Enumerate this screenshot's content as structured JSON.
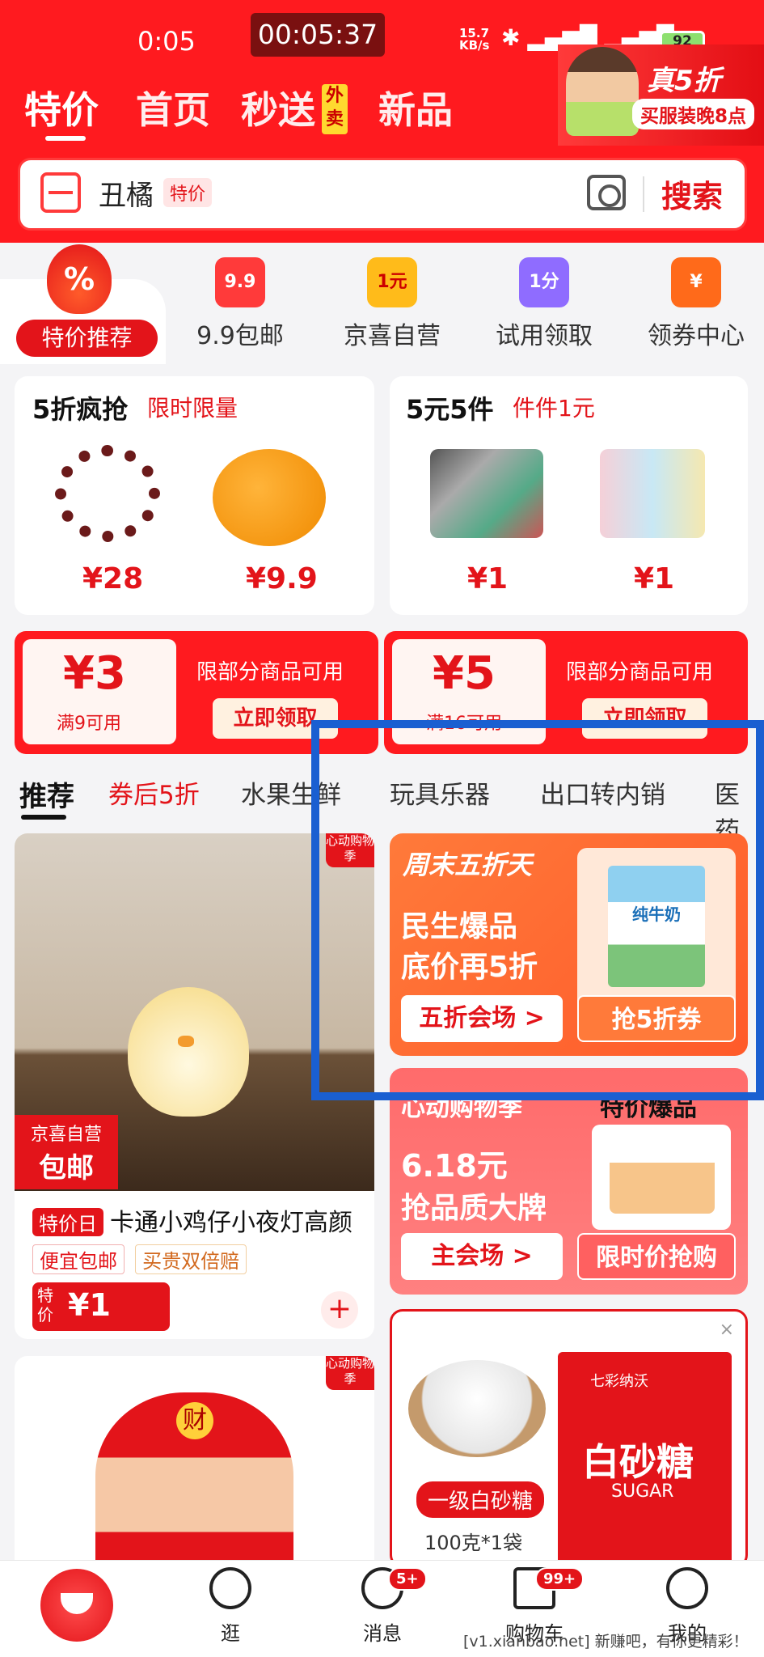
{
  "status_bar": {
    "time": "0:05",
    "timer": "00:05:37",
    "net_speed": "15.7 KB/s",
    "battery": "92"
  },
  "top_tabs": {
    "tab1": "特价",
    "tab2": "首页",
    "tab3": "秒送",
    "tab3_badge": "外卖",
    "tab4": "新品"
  },
  "promo": {
    "title": "真5折",
    "subtitle": "买服装晚8点"
  },
  "search": {
    "query": "丑橘",
    "badge": "特价",
    "button": "搜索"
  },
  "quick_nav": {
    "active": {
      "icon_text": "%",
      "label": "特价推荐"
    },
    "items": [
      {
        "icon": "9.9",
        "label": "9.9包邮",
        "color": "#ff3a3a"
      },
      {
        "icon": "1元",
        "label": "京喜自营",
        "color": "#ffbb1a"
      },
      {
        "icon": "1分",
        "label": "试用领取",
        "color": "#8f6cff"
      },
      {
        "icon": "¥",
        "label": "领券中心",
        "color": "#ff6a1a"
      }
    ]
  },
  "deal_left": {
    "title": "5折疯抢",
    "sub": "限时限量",
    "p1": "¥28",
    "p2": "¥9.9"
  },
  "deal_right": {
    "title": "5元5件",
    "sub": "件件1元",
    "p1": "¥1",
    "p2": "¥1"
  },
  "coupons": [
    {
      "amount": "¥3",
      "cond": "满9可用",
      "desc": "限部分商品可用",
      "btn": "立即领取"
    },
    {
      "amount": "¥5",
      "cond": "满16可用",
      "desc": "限部分商品可用",
      "btn": "立即领取"
    }
  ],
  "categories": {
    "c1": "推荐",
    "c2": "券后5折",
    "c3": "水果生鲜",
    "c4": "玩具乐器",
    "c5": "出口转内销",
    "c6": "医药"
  },
  "product1": {
    "corner": "心动购物季",
    "self_a": "京喜自营",
    "self_b": "包邮",
    "tag": "特价日",
    "title": "卡通小鸡仔小夜灯高颜",
    "badge1": "便宜包邮",
    "badge2": "买贵双倍赔",
    "price_label": "特价",
    "price": "¥1"
  },
  "product2": {
    "corner": "心动购物季",
    "char": "财"
  },
  "ad1": {
    "title": "周末五折天",
    "h1": "民生爆品",
    "h2": "底价再5折",
    "btn": "五折会场 >",
    "pbtn": "抢5折券",
    "pname": "纯牛奶"
  },
  "ad2": {
    "title": "心动购物季",
    "right": "特价爆品",
    "h1": "6.18元",
    "h2": "抢品质大牌",
    "btn": "主会场 >",
    "pbtn": "限时价抢购"
  },
  "ad3": {
    "close": "×",
    "tag": "一级白砂糖",
    "qty": "100克*1袋",
    "brand": "七彩纳沃",
    "name": "白砂糖",
    "en": "SUGAR"
  },
  "bottom_nav": {
    "b2": "逛",
    "b3": "消息",
    "b3_badge": "5+",
    "b4": "购物车",
    "b4_badge": "99+",
    "b5": "我的"
  },
  "watermark": "[v1.xianbao.net] 新赚吧，有你更精彩！",
  "colors": {
    "brand_red": "#ff1a1f",
    "highlight_blue": "#1a5fd1"
  }
}
